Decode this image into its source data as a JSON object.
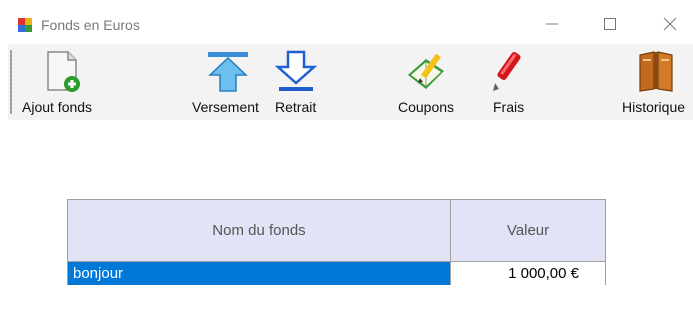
{
  "window": {
    "title": "Fonds en Euros",
    "controls": {
      "minimize": "minimize-icon",
      "maximize": "maximize-icon",
      "close": "close-icon"
    }
  },
  "toolbar": {
    "buttons": [
      {
        "id": "ajout",
        "label": "Ajout fonds",
        "icon": "add-document-icon"
      },
      {
        "id": "versement",
        "label": "Versement",
        "icon": "arrow-up-icon"
      },
      {
        "id": "retrait",
        "label": "Retrait",
        "icon": "arrow-down-icon"
      },
      {
        "id": "coupons",
        "label": "Coupons",
        "icon": "book-pencil-icon"
      },
      {
        "id": "frais",
        "label": "Frais",
        "icon": "red-pen-icon"
      },
      {
        "id": "historique",
        "label": "Historique",
        "icon": "history-book-icon"
      }
    ]
  },
  "grid": {
    "columns": [
      "Nom du fonds",
      "Valeur"
    ],
    "rows": [
      {
        "name": "bonjour",
        "value": "1 000,00 €",
        "selected": true
      }
    ]
  },
  "colors": {
    "selection": "#0078d7",
    "header_bg": "#e3e3f7",
    "toolbar_bg": "#f3f3f3"
  }
}
